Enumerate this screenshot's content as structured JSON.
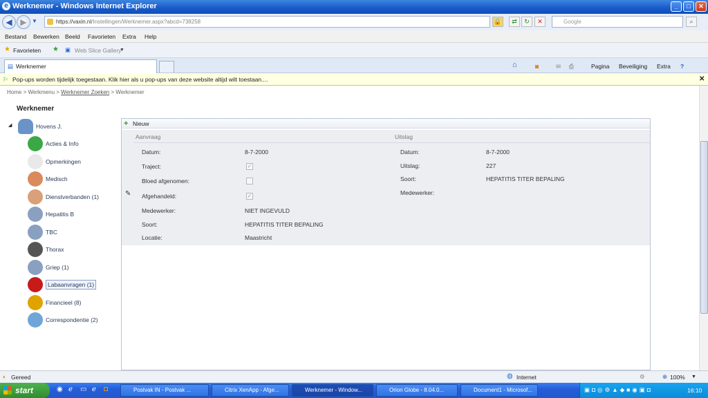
{
  "window": {
    "title": "Werknemer - Windows Internet Explorer",
    "min": "_",
    "max": "□",
    "close": "✕"
  },
  "address": {
    "url_host": "https://vaxin.nl",
    "url_path": "/Instellingen/Werknemer.aspx?abcd=738258",
    "search_placeholder": "Google"
  },
  "menu": [
    "Bestand",
    "Bewerken",
    "Beeld",
    "Favorieten",
    "Extra",
    "Help"
  ],
  "favbar": {
    "favorites": "Favorieten",
    "gallery": "Web Slice Gallery"
  },
  "tab": {
    "label": "Werknemer"
  },
  "commands": [
    "Pagina",
    "Beveiliging",
    "Extra"
  ],
  "infobar": "Pop-ups worden tijdelijk toegestaan. Klik hier als u pop-ups van deze website altijd wilt toestaan....",
  "breadcrumb": {
    "home": "Home",
    "menu": "Werkmenu",
    "search": "Werknemer Zoeken",
    "current": "Werknemer",
    "sep": ">"
  },
  "sidebar": {
    "title": "Werknemer",
    "person": "Hovens J.",
    "items": [
      {
        "label": "Acties & Info",
        "color": "#3aa845"
      },
      {
        "label": "Opmerkingen",
        "color": "#e9e9e9"
      },
      {
        "label": "Medisch",
        "color": "#d98b5c"
      },
      {
        "label": "Dienstverbanden (1)",
        "color": "#d9a07a"
      },
      {
        "label": "Hepatitis B",
        "color": "#8aa0c0"
      },
      {
        "label": "TBC",
        "color": "#8aa0c0"
      },
      {
        "label": "Thorax",
        "color": "#555555"
      },
      {
        "label": "Griep (1)",
        "color": "#8aa0c0"
      },
      {
        "label": "Labaanvragen (1)",
        "color": "#c81a1a"
      },
      {
        "label": "Financieel (8)",
        "color": "#e0a400"
      },
      {
        "label": "Correspondentie (2)",
        "color": "#6fa6d8"
      }
    ]
  },
  "panel": {
    "new_label": "Nieuw",
    "aanvraag": {
      "heading": "Aanvraag",
      "datum_label": "Datum:",
      "datum": "8-7-2000",
      "traject_label": "Traject:",
      "bloed_label": "Bloed afgenomen:",
      "afgehandeld_label": "Afgehandeld:",
      "medewerker_label": "Medewerker:",
      "medewerker": "NIET INGEVULD",
      "soort_label": "Soort:",
      "soort": "HEPATITIS TITER BEPALING",
      "locatie_label": "Locatie:",
      "locatie": "Maastricht"
    },
    "uitslag": {
      "heading": "Uitslag",
      "datum_label": "Datum:",
      "datum": "8-7-2000",
      "uitslag_label": "Uitslag:",
      "uitslag": "227",
      "soort_label": "Soort:",
      "soort": "HEPATITIS TITER BEPALING",
      "medewerker_label": "Medewerker:"
    }
  },
  "status": {
    "text": "Gereed",
    "zone": "Internet",
    "zoom": "100%"
  },
  "taskbar": {
    "start": "start",
    "buttons": [
      "Postvak IN - Postvak ...",
      "Citrix XenApp - Afge...",
      "Werknemer - Window...",
      "Orion Globe - 8.04.0...",
      "Document1 - Microsof..."
    ],
    "clock": "16:10"
  }
}
